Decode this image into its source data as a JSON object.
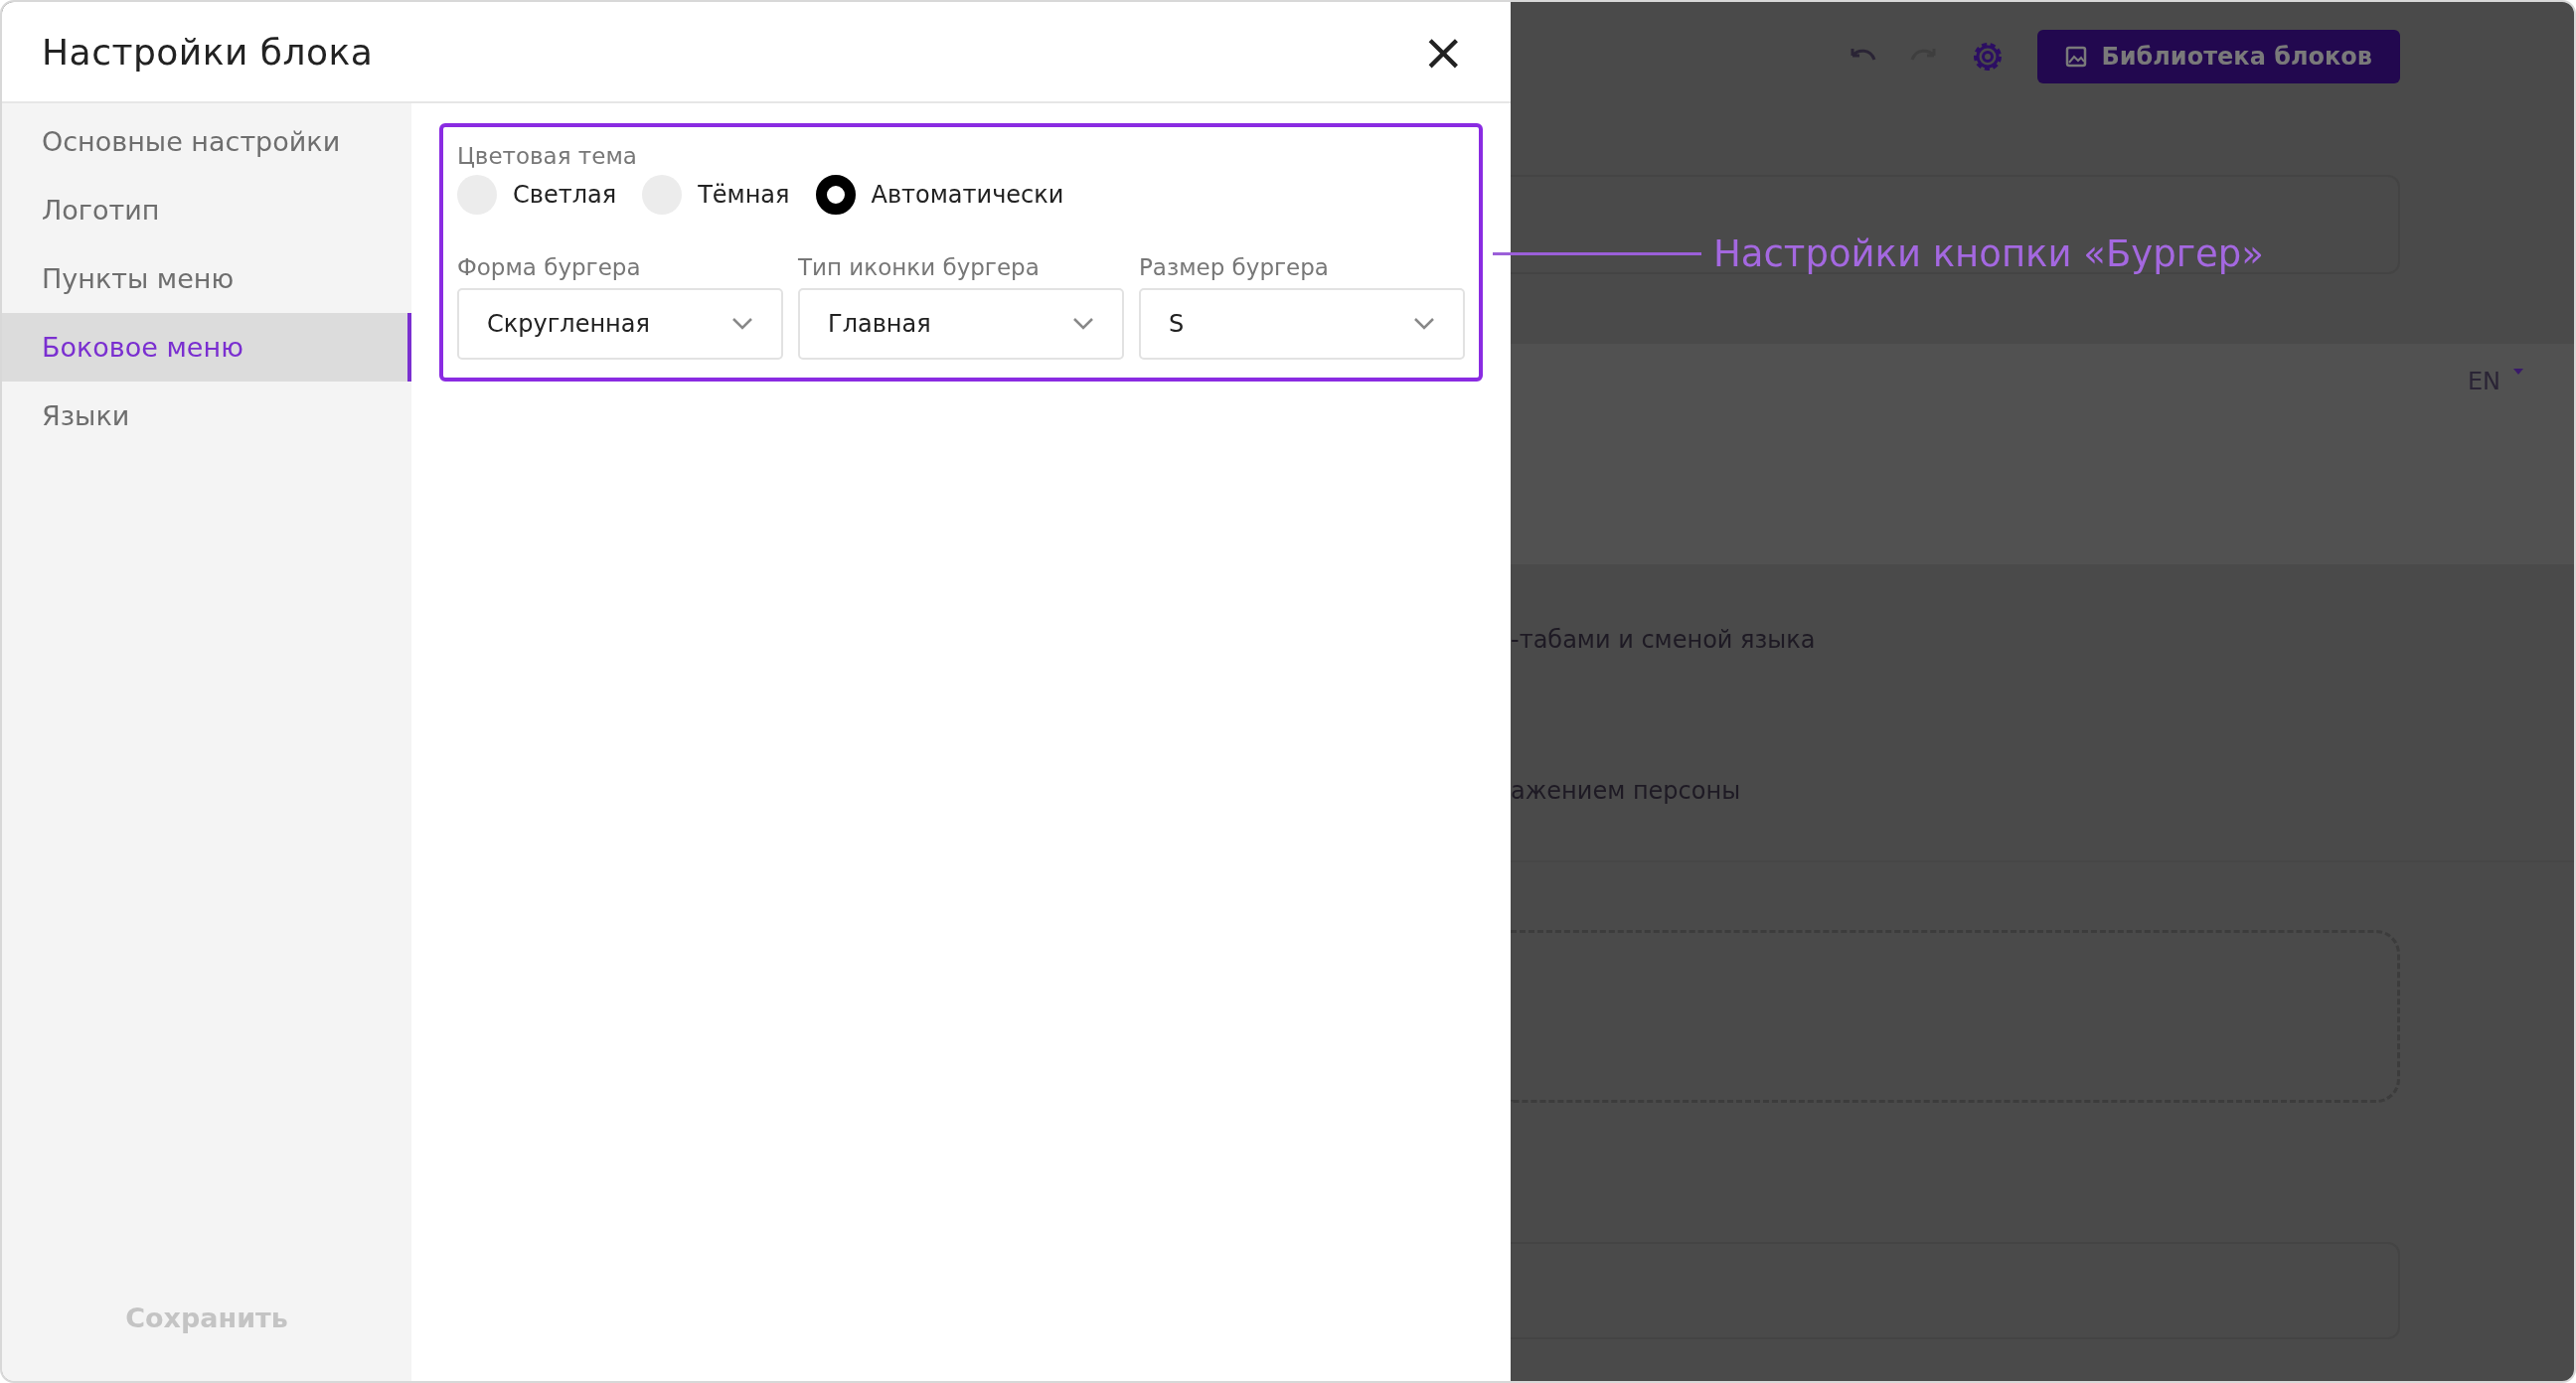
{
  "dialog": {
    "title": "Настройки блока",
    "close": "×"
  },
  "sidebar": {
    "items": [
      {
        "label": "Основные настройки",
        "selected": false
      },
      {
        "label": "Логотип",
        "selected": false
      },
      {
        "label": "Пункты меню",
        "selected": false
      },
      {
        "label": "Боковое меню",
        "selected": true
      },
      {
        "label": "Языки",
        "selected": false
      }
    ],
    "save_button": {
      "label": "Сохранить",
      "disabled": true
    }
  },
  "color_theme": {
    "label": "Цветовая тема",
    "options": [
      {
        "label": "Светлая",
        "selected": false
      },
      {
        "label": "Тёмная",
        "selected": false
      },
      {
        "label": "Автоматически",
        "selected": true
      }
    ]
  },
  "dropdowns": [
    {
      "label": "Форма бургера",
      "value": "Скругленная"
    },
    {
      "label": "Тип иконки бургера",
      "value": "Главная"
    },
    {
      "label": "Размер бургера",
      "value": "S"
    }
  ],
  "annotation": "Настройки кнопки «Бургер»",
  "background": {
    "library_button": "Библиотека блоков",
    "language": "EN",
    "texts": [
      "-табами и сменой языка",
      "ажением персоны"
    ]
  }
}
